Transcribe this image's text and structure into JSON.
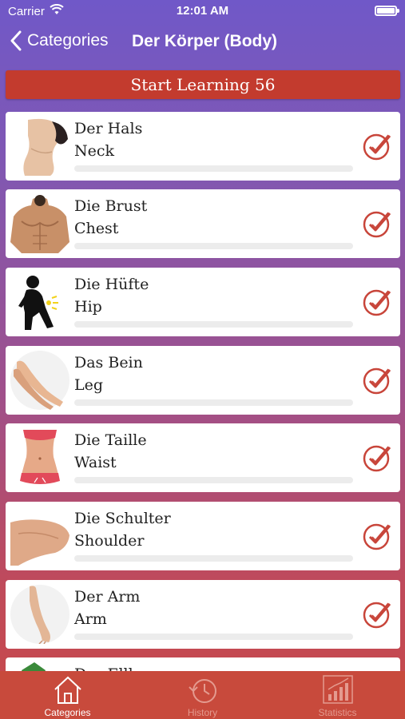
{
  "status_bar": {
    "carrier": "Carrier",
    "time": "12:01 AM"
  },
  "nav": {
    "back_label": "Categories",
    "title": "Der Körper (Body)"
  },
  "start_button": {
    "label": "Start Learning 56"
  },
  "items": [
    {
      "german": "Der Hals",
      "english": "Neck",
      "progress": 0,
      "thumb_icon": "neck-photo-icon"
    },
    {
      "german": "Die Brust",
      "english": "Chest",
      "progress": 0,
      "thumb_icon": "chest-photo-icon"
    },
    {
      "german": "Die Hüfte",
      "english": "Hip",
      "progress": 0,
      "thumb_icon": "hip-pain-icon"
    },
    {
      "german": "Das Bein",
      "english": "Leg",
      "progress": 0,
      "thumb_icon": "legs-photo-icon"
    },
    {
      "german": "Die Taille",
      "english": "Waist",
      "progress": 0,
      "thumb_icon": "waist-photo-icon"
    },
    {
      "german": "Die Schulter",
      "english": "Shoulder",
      "progress": 0,
      "thumb_icon": "shoulder-photo-icon"
    },
    {
      "german": "Der Arm",
      "english": "Arm",
      "progress": 0,
      "thumb_icon": "arm-photo-icon"
    },
    {
      "german": "Der Ellbogen",
      "english": "",
      "progress": 0,
      "thumb_icon": "elbow-photo-icon"
    }
  ],
  "tabs": [
    {
      "label": "Categories",
      "icon": "home-icon",
      "active": true
    },
    {
      "label": "History",
      "icon": "history-icon",
      "active": false
    },
    {
      "label": "Statistics",
      "icon": "statistics-icon",
      "active": false
    }
  ],
  "colors": {
    "accent_red": "#c33b2e",
    "check_red": "#c8453a",
    "tab_bar": "#c84a3c",
    "header_purple": "#7058c8"
  }
}
